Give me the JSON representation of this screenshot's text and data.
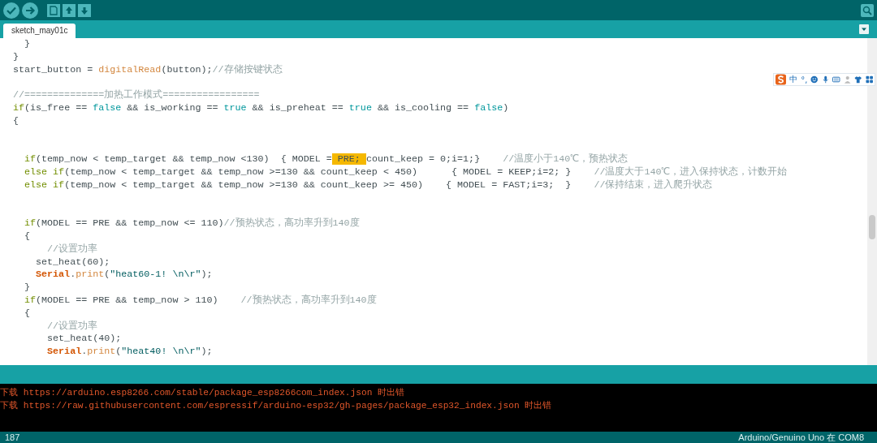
{
  "tabs": [
    {
      "label": "sketch_may01c",
      "selected": true
    }
  ],
  "ime_toolbar": {
    "mode": "中",
    "punctuation": "°,"
  },
  "code_lines": [
    {
      "kind": "code",
      "tokens": [
        {
          "kind": "plain",
          "text": "  }"
        }
      ]
    },
    {
      "kind": "code",
      "tokens": [
        {
          "kind": "plain",
          "text": "}"
        }
      ]
    },
    {
      "kind": "code",
      "tokens": [
        {
          "kind": "plain",
          "text": "start_button = "
        },
        {
          "kind": "function",
          "text": "digitalRead"
        },
        {
          "kind": "plain",
          "text": "(button);"
        },
        {
          "kind": "comment",
          "text": "//存储按键状态"
        }
      ]
    },
    {
      "kind": "blank"
    },
    {
      "kind": "code",
      "tokens": [
        {
          "kind": "comment",
          "text": "//==============加热工作模式================="
        }
      ]
    },
    {
      "kind": "code",
      "tokens": [
        {
          "kind": "keyword",
          "text": "if"
        },
        {
          "kind": "plain",
          "text": "(is_free == "
        },
        {
          "kind": "constant",
          "text": "false"
        },
        {
          "kind": "plain",
          "text": " && is_working == "
        },
        {
          "kind": "constant",
          "text": "true"
        },
        {
          "kind": "plain",
          "text": " && is_preheat == "
        },
        {
          "kind": "constant",
          "text": "true"
        },
        {
          "kind": "plain",
          "text": " && is_cooling == "
        },
        {
          "kind": "constant",
          "text": "false"
        },
        {
          "kind": "plain",
          "text": ")"
        }
      ]
    },
    {
      "kind": "code",
      "tokens": [
        {
          "kind": "plain",
          "text": "{"
        }
      ]
    },
    {
      "kind": "blank"
    },
    {
      "kind": "blank"
    },
    {
      "kind": "code",
      "tokens": [
        {
          "kind": "keyword",
          "text": "  if"
        },
        {
          "kind": "plain",
          "text": "(temp_now < temp_target && temp_now <130)  { MODEL ="
        },
        {
          "kind": "highlight",
          "text": " PRE; "
        },
        {
          "kind": "plain",
          "text": "count_keep = 0;i=1;}    "
        },
        {
          "kind": "comment",
          "text": "//温度小于140℃，预热状态"
        }
      ]
    },
    {
      "kind": "code",
      "tokens": [
        {
          "kind": "keyword",
          "text": "  else if"
        },
        {
          "kind": "plain",
          "text": "(temp_now < temp_target && temp_now >=130 && count_keep < 450)      { MODEL = KEEP;i=2; }    "
        },
        {
          "kind": "comment",
          "text": "//温度大于140℃，进入保持状态，计数开始"
        }
      ]
    },
    {
      "kind": "code",
      "tokens": [
        {
          "kind": "keyword",
          "text": "  else if"
        },
        {
          "kind": "plain",
          "text": "(temp_now < temp_target && temp_now >=130 && count_keep >= 450)    { MODEL = FAST;i=3;  }    "
        },
        {
          "kind": "comment",
          "text": "//保持结束，进入爬升状态"
        }
      ]
    },
    {
      "kind": "blank"
    },
    {
      "kind": "blank"
    },
    {
      "kind": "code",
      "tokens": [
        {
          "kind": "keyword",
          "text": "  if"
        },
        {
          "kind": "plain",
          "text": "(MODEL == PRE && temp_now <= 110)"
        },
        {
          "kind": "comment",
          "text": "//预热状态，高功率升到140度"
        }
      ]
    },
    {
      "kind": "code",
      "tokens": [
        {
          "kind": "plain",
          "text": "  {"
        }
      ]
    },
    {
      "kind": "code",
      "tokens": [
        {
          "kind": "comment",
          "text": "      //设置功率"
        }
      ]
    },
    {
      "kind": "code",
      "tokens": [
        {
          "kind": "plain",
          "text": "    set_heat(60);"
        }
      ]
    },
    {
      "kind": "code",
      "tokens": [
        {
          "kind": "object",
          "text": "    Serial"
        },
        {
          "kind": "plain",
          "text": "."
        },
        {
          "kind": "function",
          "text": "print"
        },
        {
          "kind": "plain",
          "text": "("
        },
        {
          "kind": "string",
          "text": "\"heat60-1! \\n\\r\""
        },
        {
          "kind": "plain",
          "text": ");"
        }
      ]
    },
    {
      "kind": "code",
      "tokens": [
        {
          "kind": "plain",
          "text": "  }"
        }
      ]
    },
    {
      "kind": "code",
      "tokens": [
        {
          "kind": "keyword",
          "text": "  if"
        },
        {
          "kind": "plain",
          "text": "(MODEL == PRE && temp_now > 110)    "
        },
        {
          "kind": "comment",
          "text": "//预热状态，高功率升到140度"
        }
      ]
    },
    {
      "kind": "code",
      "tokens": [
        {
          "kind": "plain",
          "text": "  {"
        }
      ]
    },
    {
      "kind": "code",
      "tokens": [
        {
          "kind": "comment",
          "text": "      //设置功率"
        }
      ]
    },
    {
      "kind": "code",
      "tokens": [
        {
          "kind": "plain",
          "text": "      set_heat(40);"
        }
      ]
    },
    {
      "kind": "code",
      "tokens": [
        {
          "kind": "object",
          "text": "      Serial"
        },
        {
          "kind": "plain",
          "text": "."
        },
        {
          "kind": "function",
          "text": "print"
        },
        {
          "kind": "plain",
          "text": "("
        },
        {
          "kind": "string",
          "text": "\"heat40! \\n\\r\""
        },
        {
          "kind": "plain",
          "text": ");"
        }
      ]
    }
  ],
  "console": {
    "lines": [
      "下载 https://arduino.esp8266.com/stable/package_esp8266com_index.json 时出错",
      "下载 https://raw.githubusercontent.com/espressif/arduino-esp32/gh-pages/package_esp32_index.json 时出错"
    ]
  },
  "status_bar": {
    "line": "187",
    "board": "Arduino/Genuino Uno 在 COM8"
  }
}
